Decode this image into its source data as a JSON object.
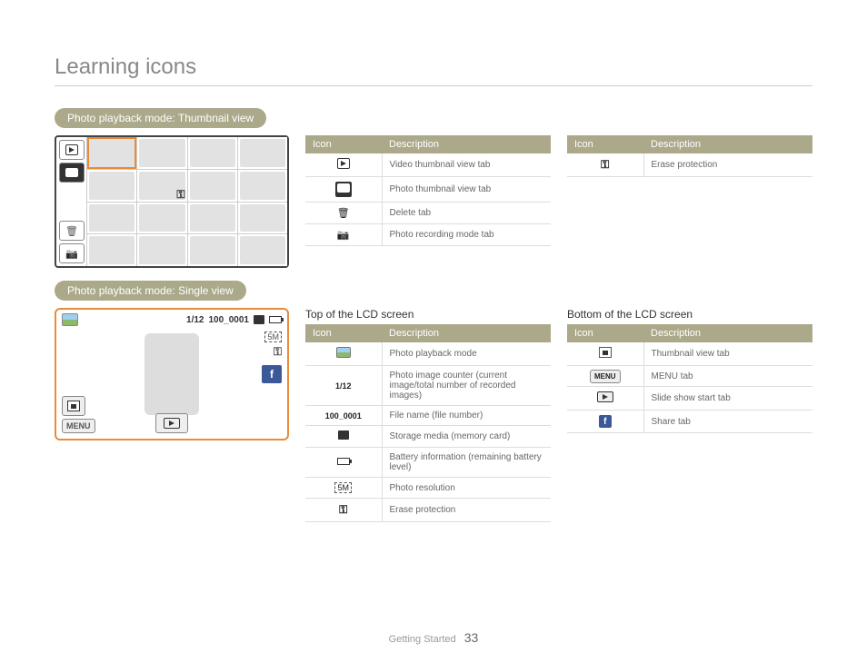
{
  "page_title": "Learning icons",
  "sections": {
    "thumb": {
      "heading": "Photo playback mode: Thumbnail view",
      "table1": {
        "headers": [
          "Icon",
          "Description"
        ],
        "rows": [
          {
            "icon": "video-tab",
            "desc": "Video thumbnail view tab"
          },
          {
            "icon": "photo-tab",
            "desc": "Photo thumbnail view tab"
          },
          {
            "icon": "delete-tab",
            "desc": "Delete tab"
          },
          {
            "icon": "camera-tab",
            "desc": "Photo recording mode tab"
          }
        ]
      },
      "table2": {
        "headers": [
          "Icon",
          "Description"
        ],
        "rows": [
          {
            "icon": "key",
            "desc": "Erase protection"
          }
        ]
      }
    },
    "single": {
      "heading": "Photo playback mode: Single view",
      "lcd": {
        "counter": "1/12",
        "filename": "100_0001",
        "menu_label": "MENU"
      },
      "top": {
        "label": "Top of the LCD screen",
        "headers": [
          "Icon",
          "Description"
        ],
        "rows": [
          {
            "icon": "playback",
            "desc": "Photo playback mode"
          },
          {
            "icon": "1/12",
            "desc": "Photo image counter (current image/total number of recorded images)"
          },
          {
            "icon": "100_0001",
            "desc": "File name (file number)"
          },
          {
            "icon": "card",
            "desc": "Storage media (memory card)"
          },
          {
            "icon": "battery",
            "desc": "Battery information (remaining battery level)"
          },
          {
            "icon": "res",
            "desc": "Photo resolution"
          },
          {
            "icon": "key",
            "desc": "Erase protection"
          }
        ]
      },
      "bottom": {
        "label": "Bottom of the LCD screen",
        "headers": [
          "Icon",
          "Description"
        ],
        "rows": [
          {
            "icon": "grid",
            "desc": "Thumbnail view tab"
          },
          {
            "icon": "MENU",
            "desc": "MENU tab"
          },
          {
            "icon": "slide",
            "desc": "Slide show start tab"
          },
          {
            "icon": "fb",
            "desc": "Share tab"
          }
        ]
      }
    }
  },
  "footer": {
    "section": "Getting Started",
    "page": "33"
  }
}
